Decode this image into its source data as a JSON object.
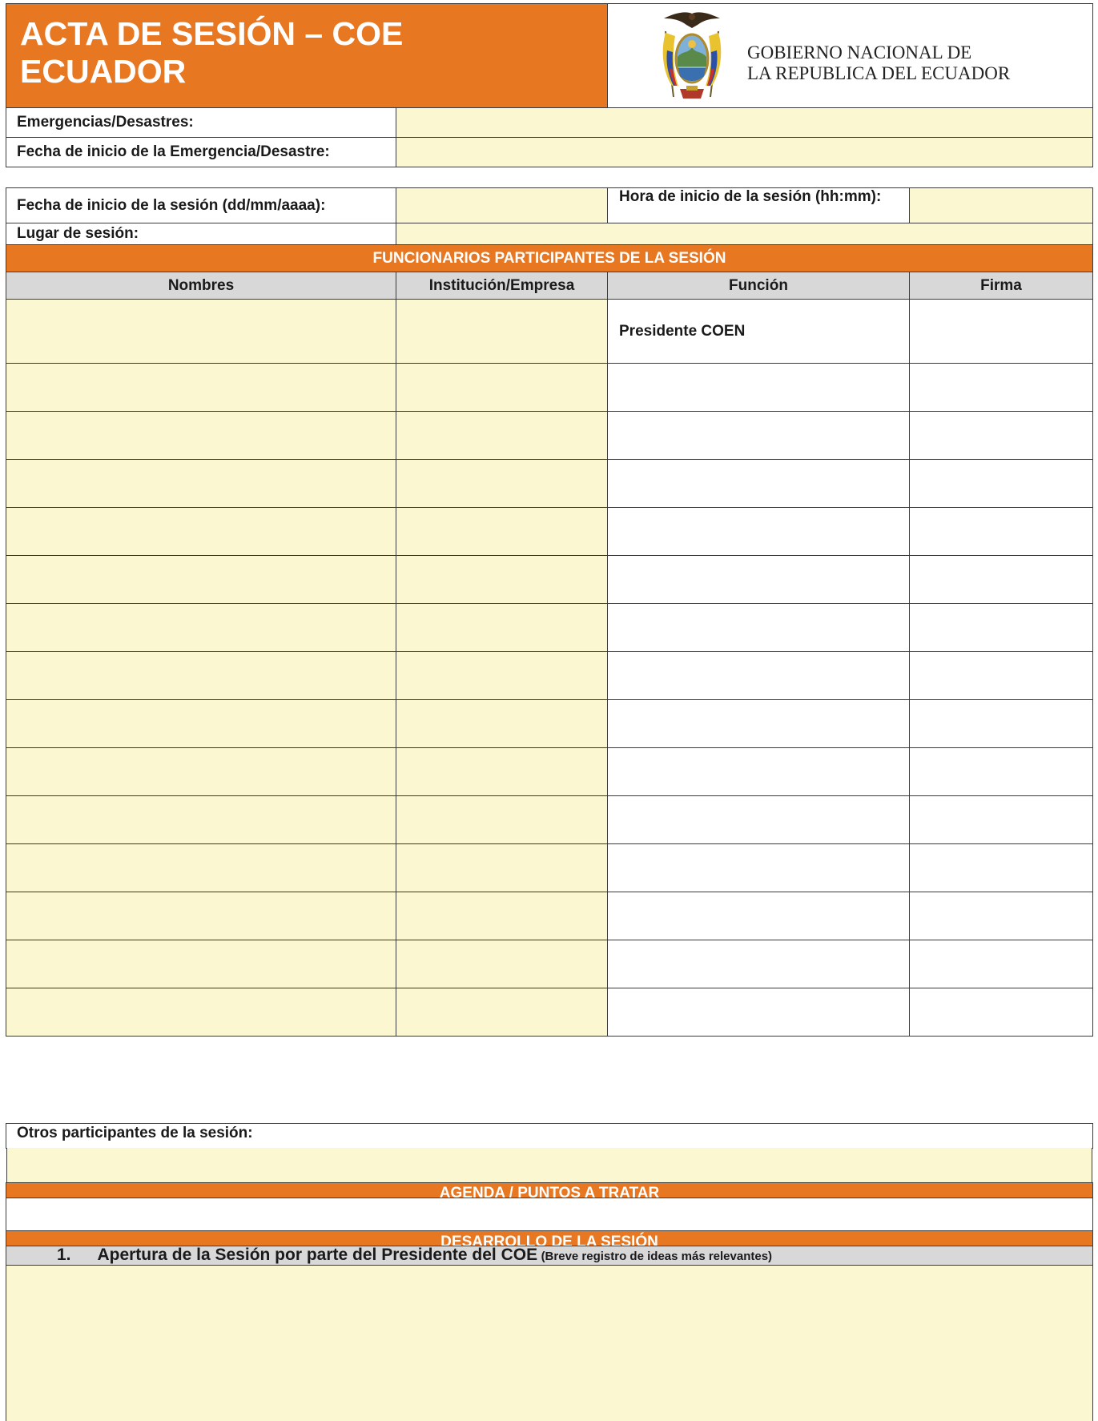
{
  "header": {
    "title_line1": "ACTA DE SESIÓN – COE",
    "title_line2": "ECUADOR",
    "gov_line1": "GOBIERNO NACIONAL DE",
    "gov_line2": "LA REPUBLICA DEL ECUADOR",
    "logo_icon": "ecuador-coat-of-arms-icon"
  },
  "emergency": {
    "emergencias_label": "Emergencias/Desastres:",
    "emergencias_value": "",
    "fecha_emergencia_label": "Fecha de inicio de la Emergencia/Desastre:",
    "fecha_emergencia_value": ""
  },
  "session": {
    "fecha_label": "Fecha de inicio de la sesión (dd/mm/aaaa):",
    "fecha_value": "",
    "hora_label": "Hora de inicio de la sesión (hh:mm):",
    "hora_value": "",
    "lugar_label": "Lugar de sesión:",
    "lugar_value": ""
  },
  "participants": {
    "section_title": "FUNCIONARIOS PARTICIPANTES DE LA SESIÓN",
    "columns": [
      "Nombres",
      "Institución/Empresa",
      "Función",
      "Firma"
    ],
    "rows": [
      {
        "nombre": "",
        "institucion": "",
        "funcion": "Presidente COEN",
        "firma": ""
      },
      {
        "nombre": "",
        "institucion": "",
        "funcion": "",
        "firma": ""
      },
      {
        "nombre": "",
        "institucion": "",
        "funcion": "",
        "firma": ""
      },
      {
        "nombre": "",
        "institucion": "",
        "funcion": "",
        "firma": ""
      },
      {
        "nombre": "",
        "institucion": "",
        "funcion": "",
        "firma": ""
      },
      {
        "nombre": "",
        "institucion": "",
        "funcion": "",
        "firma": ""
      },
      {
        "nombre": "",
        "institucion": "",
        "funcion": "",
        "firma": ""
      },
      {
        "nombre": "",
        "institucion": "",
        "funcion": "",
        "firma": ""
      },
      {
        "nombre": "",
        "institucion": "",
        "funcion": "",
        "firma": ""
      },
      {
        "nombre": "",
        "institucion": "",
        "funcion": "",
        "firma": ""
      },
      {
        "nombre": "",
        "institucion": "",
        "funcion": "",
        "firma": ""
      },
      {
        "nombre": "",
        "institucion": "",
        "funcion": "",
        "firma": ""
      },
      {
        "nombre": "",
        "institucion": "",
        "funcion": "",
        "firma": ""
      },
      {
        "nombre": "",
        "institucion": "",
        "funcion": "",
        "firma": ""
      },
      {
        "nombre": "",
        "institucion": "",
        "funcion": "",
        "firma": ""
      }
    ],
    "otros_label": "Otros participantes de la sesión:",
    "otros_value": ""
  },
  "agenda": {
    "section_title": "AGENDA / PUNTOS A TRATAR",
    "value": ""
  },
  "desarrollo": {
    "section_title": "DESARROLLO DE LA SESIÓN",
    "item_number": "1.",
    "item_title": "Apertura de la Sesión por parte del Presidente del COE",
    "item_note": "(Breve registro de ideas más relevantes)",
    "item_value": ""
  },
  "colors": {
    "accent_orange": "#e87722",
    "field_yellow": "#fbf7d0",
    "header_gray": "#d8d8d8"
  }
}
